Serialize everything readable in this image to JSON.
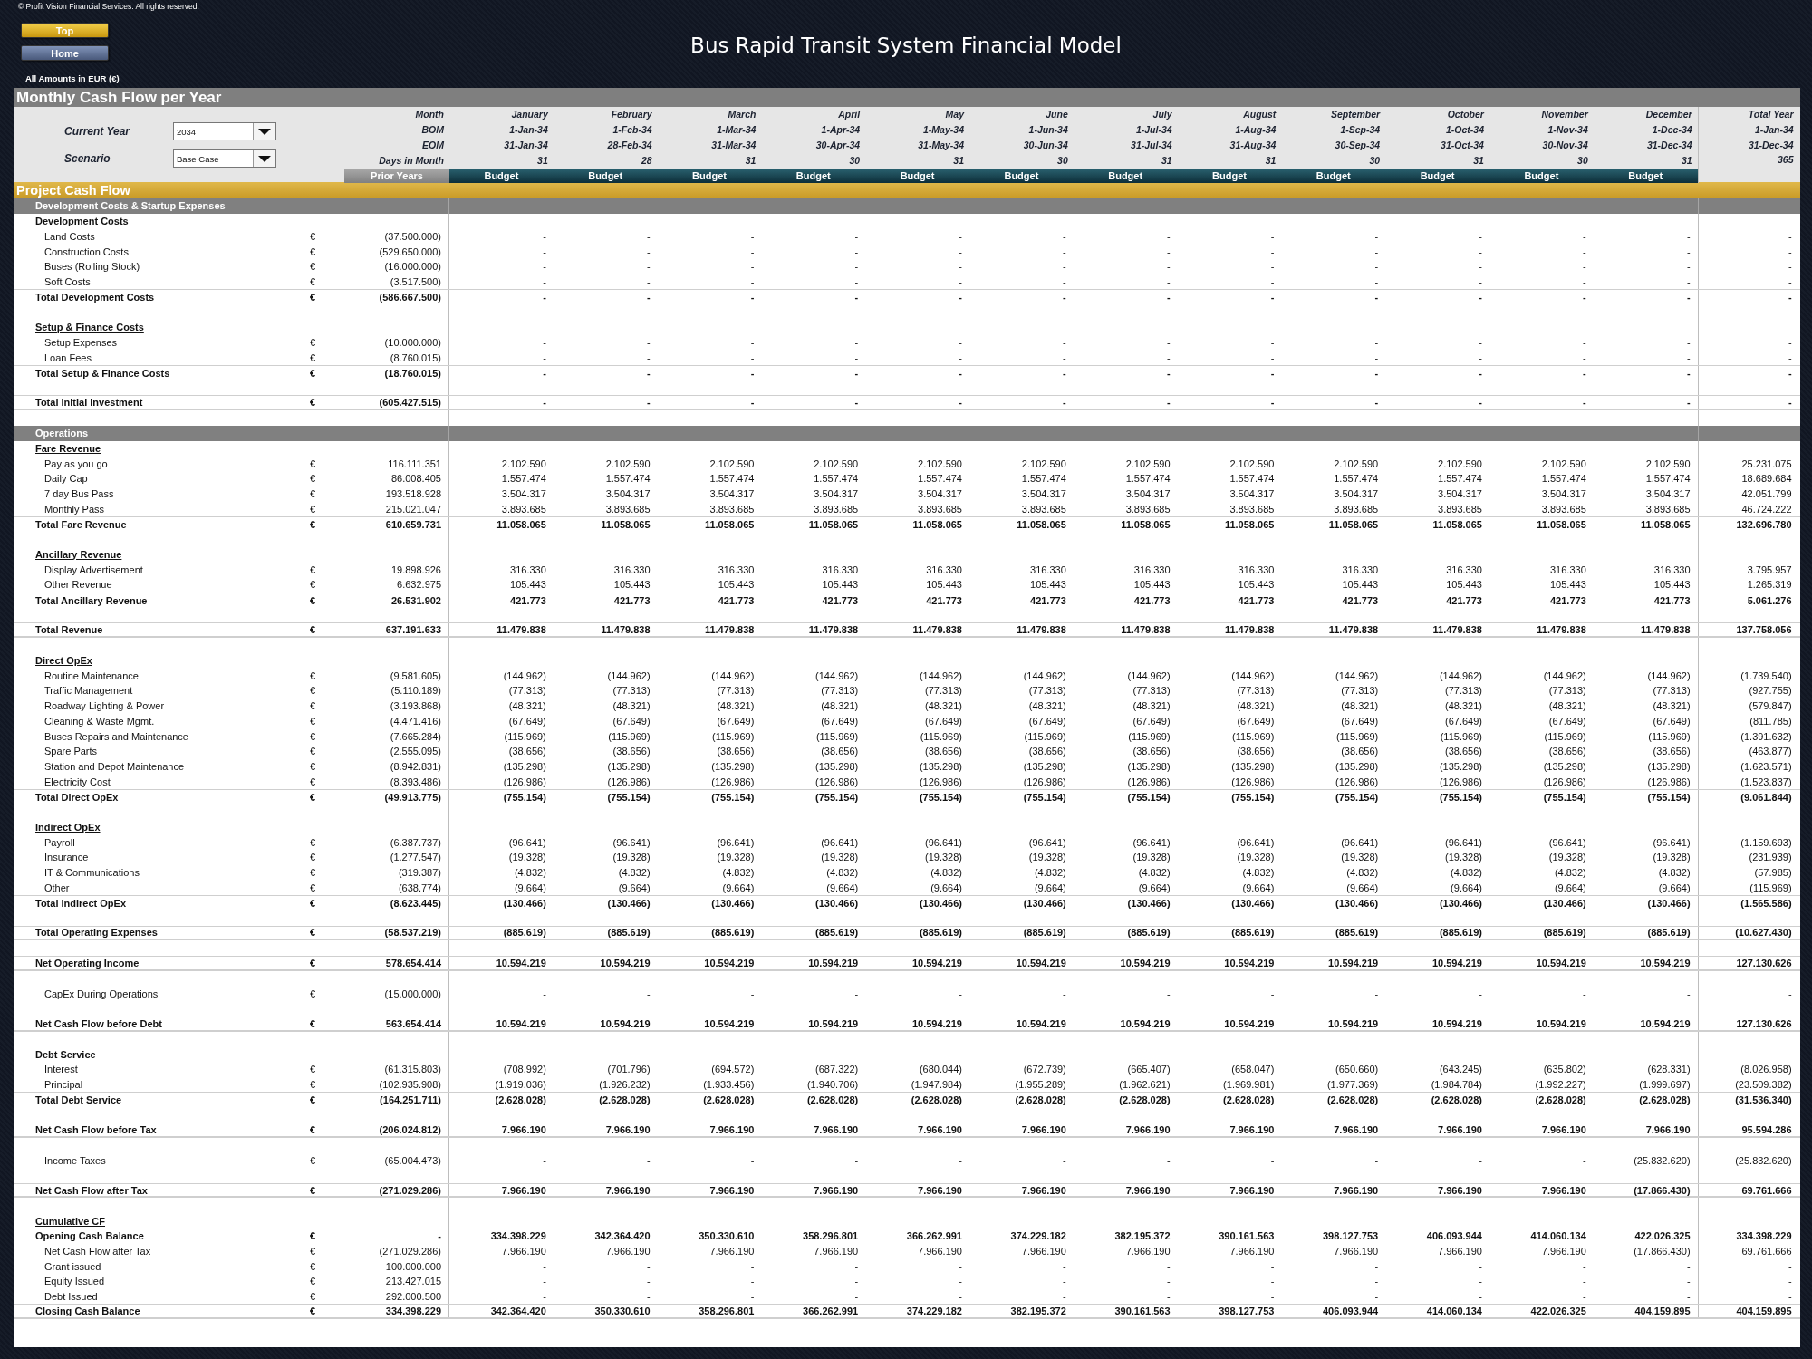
{
  "copyright": "© Profit Vision Financial Services. All rights reserved.",
  "nav_buttons": [
    "Top",
    "Home"
  ],
  "title": "Bus Rapid Transit System Financial Model",
  "amounts_note": "All Amounts in  EUR (€)",
  "sheet_title": "Monthly Cash Flow per Year",
  "controls": [
    {
      "label": "Current Year",
      "value": "2034"
    },
    {
      "label": "Scenario",
      "value": "Base Case"
    }
  ],
  "header_labels": {
    "month": "Month",
    "bom": "BOM",
    "eom": "EOM",
    "days": "Days in Month",
    "prior": "Prior Years"
  },
  "columns": [
    {
      "month": "January",
      "bom": "1-Jan-34",
      "eom": "31-Jan-34",
      "days": "31",
      "status": "Budget"
    },
    {
      "month": "February",
      "bom": "1-Feb-34",
      "eom": "28-Feb-34",
      "days": "28",
      "status": "Budget"
    },
    {
      "month": "March",
      "bom": "1-Mar-34",
      "eom": "31-Mar-34",
      "days": "31",
      "status": "Budget"
    },
    {
      "month": "April",
      "bom": "1-Apr-34",
      "eom": "30-Apr-34",
      "days": "30",
      "status": "Budget"
    },
    {
      "month": "May",
      "bom": "1-May-34",
      "eom": "31-May-34",
      "days": "31",
      "status": "Budget"
    },
    {
      "month": "June",
      "bom": "1-Jun-34",
      "eom": "30-Jun-34",
      "days": "30",
      "status": "Budget"
    },
    {
      "month": "July",
      "bom": "1-Jul-34",
      "eom": "31-Jul-34",
      "days": "31",
      "status": "Budget"
    },
    {
      "month": "August",
      "bom": "1-Aug-34",
      "eom": "31-Aug-34",
      "days": "31",
      "status": "Budget"
    },
    {
      "month": "September",
      "bom": "1-Sep-34",
      "eom": "30-Sep-34",
      "days": "30",
      "status": "Budget"
    },
    {
      "month": "October",
      "bom": "1-Oct-34",
      "eom": "31-Oct-34",
      "days": "31",
      "status": "Budget"
    },
    {
      "month": "November",
      "bom": "1-Nov-34",
      "eom": "30-Nov-34",
      "days": "30",
      "status": "Budget"
    },
    {
      "month": "December",
      "bom": "1-Dec-34",
      "eom": "31-Dec-34",
      "days": "31",
      "status": "Budget"
    }
  ],
  "total_column": {
    "month": "Total Year",
    "bom": "1-Jan-34",
    "eom": "31-Dec-34",
    "days": "365"
  },
  "block_title": "Project Cash Flow",
  "rows": [
    {
      "kind": "section",
      "label": "Development Costs & Startup Expenses"
    },
    {
      "kind": "group",
      "label": "Development Costs"
    },
    {
      "kind": "item",
      "label": "Land Costs",
      "currency": "€",
      "prior": "(37.500.000)",
      "months": [
        "-",
        "-",
        "-",
        "-",
        "-",
        "-",
        "-",
        "-",
        "-",
        "-",
        "-",
        "-"
      ],
      "total": "-"
    },
    {
      "kind": "item",
      "label": "Construction Costs",
      "currency": "€",
      "prior": "(529.650.000)",
      "months": [
        "-",
        "-",
        "-",
        "-",
        "-",
        "-",
        "-",
        "-",
        "-",
        "-",
        "-",
        "-"
      ],
      "total": "-"
    },
    {
      "kind": "item",
      "label": "Buses (Rolling Stock)",
      "currency": "€",
      "prior": "(16.000.000)",
      "months": [
        "-",
        "-",
        "-",
        "-",
        "-",
        "-",
        "-",
        "-",
        "-",
        "-",
        "-",
        "-"
      ],
      "total": "-"
    },
    {
      "kind": "item",
      "label": "Soft Costs",
      "currency": "€",
      "prior": "(3.517.500)",
      "months": [
        "-",
        "-",
        "-",
        "-",
        "-",
        "-",
        "-",
        "-",
        "-",
        "-",
        "-",
        "-"
      ],
      "total": "-"
    },
    {
      "kind": "total",
      "label": "Total Development Costs",
      "currency": "€",
      "prior": "(586.667.500)",
      "months": [
        "-",
        "-",
        "-",
        "-",
        "-",
        "-",
        "-",
        "-",
        "-",
        "-",
        "-",
        "-"
      ],
      "total": "-"
    },
    {
      "kind": "blank"
    },
    {
      "kind": "group",
      "label": "Setup & Finance Costs"
    },
    {
      "kind": "item",
      "label": "Setup Expenses",
      "currency": "€",
      "prior": "(10.000.000)",
      "months": [
        "-",
        "-",
        "-",
        "-",
        "-",
        "-",
        "-",
        "-",
        "-",
        "-",
        "-",
        "-"
      ],
      "total": "-"
    },
    {
      "kind": "item",
      "label": "Loan Fees",
      "currency": "€",
      "prior": "(8.760.015)",
      "months": [
        "-",
        "-",
        "-",
        "-",
        "-",
        "-",
        "-",
        "-",
        "-",
        "-",
        "-",
        "-"
      ],
      "total": "-"
    },
    {
      "kind": "total",
      "label": "Total Setup & Finance Costs",
      "currency": "€",
      "prior": "(18.760.015)",
      "months": [
        "-",
        "-",
        "-",
        "-",
        "-",
        "-",
        "-",
        "-",
        "-",
        "-",
        "-",
        "-"
      ],
      "total": "-"
    },
    {
      "kind": "blank"
    },
    {
      "kind": "net",
      "label": "Total Initial Investment",
      "currency": "€",
      "prior": "(605.427.515)",
      "months": [
        "-",
        "-",
        "-",
        "-",
        "-",
        "-",
        "-",
        "-",
        "-",
        "-",
        "-",
        "-"
      ],
      "total": "-"
    },
    {
      "kind": "blank"
    },
    {
      "kind": "section",
      "label": "Operations"
    },
    {
      "kind": "group",
      "label": "Fare Revenue"
    },
    {
      "kind": "item",
      "label": "Pay as you go",
      "currency": "€",
      "prior": "116.111.351",
      "months": [
        "2.102.590",
        "2.102.590",
        "2.102.590",
        "2.102.590",
        "2.102.590",
        "2.102.590",
        "2.102.590",
        "2.102.590",
        "2.102.590",
        "2.102.590",
        "2.102.590",
        "2.102.590"
      ],
      "total": "25.231.075"
    },
    {
      "kind": "item",
      "label": "Daily Cap",
      "currency": "€",
      "prior": "86.008.405",
      "months": [
        "1.557.474",
        "1.557.474",
        "1.557.474",
        "1.557.474",
        "1.557.474",
        "1.557.474",
        "1.557.474",
        "1.557.474",
        "1.557.474",
        "1.557.474",
        "1.557.474",
        "1.557.474"
      ],
      "total": "18.689.684"
    },
    {
      "kind": "item",
      "label": "7 day Bus Pass",
      "currency": "€",
      "prior": "193.518.928",
      "months": [
        "3.504.317",
        "3.504.317",
        "3.504.317",
        "3.504.317",
        "3.504.317",
        "3.504.317",
        "3.504.317",
        "3.504.317",
        "3.504.317",
        "3.504.317",
        "3.504.317",
        "3.504.317"
      ],
      "total": "42.051.799"
    },
    {
      "kind": "item",
      "label": "Monthly Pass",
      "currency": "€",
      "prior": "215.021.047",
      "months": [
        "3.893.685",
        "3.893.685",
        "3.893.685",
        "3.893.685",
        "3.893.685",
        "3.893.685",
        "3.893.685",
        "3.893.685",
        "3.893.685",
        "3.893.685",
        "3.893.685",
        "3.893.685"
      ],
      "total": "46.724.222"
    },
    {
      "kind": "total",
      "label": "Total Fare Revenue",
      "currency": "€",
      "prior": "610.659.731",
      "months": [
        "11.058.065",
        "11.058.065",
        "11.058.065",
        "11.058.065",
        "11.058.065",
        "11.058.065",
        "11.058.065",
        "11.058.065",
        "11.058.065",
        "11.058.065",
        "11.058.065",
        "11.058.065"
      ],
      "total": "132.696.780"
    },
    {
      "kind": "blank"
    },
    {
      "kind": "group",
      "label": "Ancillary Revenue"
    },
    {
      "kind": "item",
      "label": "Display Advertisement",
      "currency": "€",
      "prior": "19.898.926",
      "months": [
        "316.330",
        "316.330",
        "316.330",
        "316.330",
        "316.330",
        "316.330",
        "316.330",
        "316.330",
        "316.330",
        "316.330",
        "316.330",
        "316.330"
      ],
      "total": "3.795.957"
    },
    {
      "kind": "item",
      "label": "Other Revenue",
      "currency": "€",
      "prior": "6.632.975",
      "months": [
        "105.443",
        "105.443",
        "105.443",
        "105.443",
        "105.443",
        "105.443",
        "105.443",
        "105.443",
        "105.443",
        "105.443",
        "105.443",
        "105.443"
      ],
      "total": "1.265.319"
    },
    {
      "kind": "total",
      "label": "Total Ancillary Revenue",
      "currency": "€",
      "prior": "26.531.902",
      "months": [
        "421.773",
        "421.773",
        "421.773",
        "421.773",
        "421.773",
        "421.773",
        "421.773",
        "421.773",
        "421.773",
        "421.773",
        "421.773",
        "421.773"
      ],
      "total": "5.061.276"
    },
    {
      "kind": "blank"
    },
    {
      "kind": "net",
      "label": "Total Revenue",
      "currency": "€",
      "prior": "637.191.633",
      "months": [
        "11.479.838",
        "11.479.838",
        "11.479.838",
        "11.479.838",
        "11.479.838",
        "11.479.838",
        "11.479.838",
        "11.479.838",
        "11.479.838",
        "11.479.838",
        "11.479.838",
        "11.479.838"
      ],
      "total": "137.758.056"
    },
    {
      "kind": "blank"
    },
    {
      "kind": "group",
      "label": "Direct OpEx"
    },
    {
      "kind": "item",
      "label": "Routine Maintenance",
      "currency": "€",
      "prior": "(9.581.605)",
      "months": [
        "(144.962)",
        "(144.962)",
        "(144.962)",
        "(144.962)",
        "(144.962)",
        "(144.962)",
        "(144.962)",
        "(144.962)",
        "(144.962)",
        "(144.962)",
        "(144.962)",
        "(144.962)"
      ],
      "total": "(1.739.540)"
    },
    {
      "kind": "item",
      "label": "Traffic Management",
      "currency": "€",
      "prior": "(5.110.189)",
      "months": [
        "(77.313)",
        "(77.313)",
        "(77.313)",
        "(77.313)",
        "(77.313)",
        "(77.313)",
        "(77.313)",
        "(77.313)",
        "(77.313)",
        "(77.313)",
        "(77.313)",
        "(77.313)"
      ],
      "total": "(927.755)"
    },
    {
      "kind": "item",
      "label": "Roadway Lighting & Power",
      "currency": "€",
      "prior": "(3.193.868)",
      "months": [
        "(48.321)",
        "(48.321)",
        "(48.321)",
        "(48.321)",
        "(48.321)",
        "(48.321)",
        "(48.321)",
        "(48.321)",
        "(48.321)",
        "(48.321)",
        "(48.321)",
        "(48.321)"
      ],
      "total": "(579.847)"
    },
    {
      "kind": "item",
      "label": "Cleaning & Waste Mgmt.",
      "currency": "€",
      "prior": "(4.471.416)",
      "months": [
        "(67.649)",
        "(67.649)",
        "(67.649)",
        "(67.649)",
        "(67.649)",
        "(67.649)",
        "(67.649)",
        "(67.649)",
        "(67.649)",
        "(67.649)",
        "(67.649)",
        "(67.649)"
      ],
      "total": "(811.785)"
    },
    {
      "kind": "item",
      "label": "Buses Repairs and Maintenance",
      "currency": "€",
      "prior": "(7.665.284)",
      "months": [
        "(115.969)",
        "(115.969)",
        "(115.969)",
        "(115.969)",
        "(115.969)",
        "(115.969)",
        "(115.969)",
        "(115.969)",
        "(115.969)",
        "(115.969)",
        "(115.969)",
        "(115.969)"
      ],
      "total": "(1.391.632)"
    },
    {
      "kind": "item",
      "label": "Spare Parts",
      "currency": "€",
      "prior": "(2.555.095)",
      "months": [
        "(38.656)",
        "(38.656)",
        "(38.656)",
        "(38.656)",
        "(38.656)",
        "(38.656)",
        "(38.656)",
        "(38.656)",
        "(38.656)",
        "(38.656)",
        "(38.656)",
        "(38.656)"
      ],
      "total": "(463.877)"
    },
    {
      "kind": "item",
      "label": "Station and Depot Maintenance",
      "currency": "€",
      "prior": "(8.942.831)",
      "months": [
        "(135.298)",
        "(135.298)",
        "(135.298)",
        "(135.298)",
        "(135.298)",
        "(135.298)",
        "(135.298)",
        "(135.298)",
        "(135.298)",
        "(135.298)",
        "(135.298)",
        "(135.298)"
      ],
      "total": "(1.623.571)"
    },
    {
      "kind": "item",
      "label": "Electricity Cost",
      "currency": "€",
      "prior": "(8.393.486)",
      "months": [
        "(126.986)",
        "(126.986)",
        "(126.986)",
        "(126.986)",
        "(126.986)",
        "(126.986)",
        "(126.986)",
        "(126.986)",
        "(126.986)",
        "(126.986)",
        "(126.986)",
        "(126.986)"
      ],
      "total": "(1.523.837)"
    },
    {
      "kind": "total",
      "label": "Total Direct OpEx",
      "currency": "€",
      "prior": "(49.913.775)",
      "months": [
        "(755.154)",
        "(755.154)",
        "(755.154)",
        "(755.154)",
        "(755.154)",
        "(755.154)",
        "(755.154)",
        "(755.154)",
        "(755.154)",
        "(755.154)",
        "(755.154)",
        "(755.154)"
      ],
      "total": "(9.061.844)"
    },
    {
      "kind": "blank"
    },
    {
      "kind": "group",
      "label": "Indirect OpEx"
    },
    {
      "kind": "item",
      "label": "Payroll",
      "currency": "€",
      "prior": "(6.387.737)",
      "months": [
        "(96.641)",
        "(96.641)",
        "(96.641)",
        "(96.641)",
        "(96.641)",
        "(96.641)",
        "(96.641)",
        "(96.641)",
        "(96.641)",
        "(96.641)",
        "(96.641)",
        "(96.641)"
      ],
      "total": "(1.159.693)"
    },
    {
      "kind": "item",
      "label": "Insurance",
      "currency": "€",
      "prior": "(1.277.547)",
      "months": [
        "(19.328)",
        "(19.328)",
        "(19.328)",
        "(19.328)",
        "(19.328)",
        "(19.328)",
        "(19.328)",
        "(19.328)",
        "(19.328)",
        "(19.328)",
        "(19.328)",
        "(19.328)"
      ],
      "total": "(231.939)"
    },
    {
      "kind": "item",
      "label": "IT & Communications",
      "currency": "€",
      "prior": "(319.387)",
      "months": [
        "(4.832)",
        "(4.832)",
        "(4.832)",
        "(4.832)",
        "(4.832)",
        "(4.832)",
        "(4.832)",
        "(4.832)",
        "(4.832)",
        "(4.832)",
        "(4.832)",
        "(4.832)"
      ],
      "total": "(57.985)"
    },
    {
      "kind": "item",
      "label": "Other",
      "currency": "€",
      "prior": "(638.774)",
      "months": [
        "(9.664)",
        "(9.664)",
        "(9.664)",
        "(9.664)",
        "(9.664)",
        "(9.664)",
        "(9.664)",
        "(9.664)",
        "(9.664)",
        "(9.664)",
        "(9.664)",
        "(9.664)"
      ],
      "total": "(115.969)"
    },
    {
      "kind": "total",
      "label": "Total Indirect OpEx",
      "currency": "€",
      "prior": "(8.623.445)",
      "months": [
        "(130.466)",
        "(130.466)",
        "(130.466)",
        "(130.466)",
        "(130.466)",
        "(130.466)",
        "(130.466)",
        "(130.466)",
        "(130.466)",
        "(130.466)",
        "(130.466)",
        "(130.466)"
      ],
      "total": "(1.565.586)"
    },
    {
      "kind": "blank"
    },
    {
      "kind": "net",
      "label": "Total Operating Expenses",
      "currency": "€",
      "prior": "(58.537.219)",
      "months": [
        "(885.619)",
        "(885.619)",
        "(885.619)",
        "(885.619)",
        "(885.619)",
        "(885.619)",
        "(885.619)",
        "(885.619)",
        "(885.619)",
        "(885.619)",
        "(885.619)",
        "(885.619)"
      ],
      "total": "(10.627.430)"
    },
    {
      "kind": "blank"
    },
    {
      "kind": "net",
      "label": "Net Operating Income",
      "currency": "€",
      "prior": "578.654.414",
      "months": [
        "10.594.219",
        "10.594.219",
        "10.594.219",
        "10.594.219",
        "10.594.219",
        "10.594.219",
        "10.594.219",
        "10.594.219",
        "10.594.219",
        "10.594.219",
        "10.594.219",
        "10.594.219"
      ],
      "total": "127.130.626"
    },
    {
      "kind": "blank"
    },
    {
      "kind": "item",
      "label": "CapEx During Operations",
      "currency": "€",
      "prior": "(15.000.000)",
      "months": [
        "-",
        "-",
        "-",
        "-",
        "-",
        "-",
        "-",
        "-",
        "-",
        "-",
        "-",
        "-"
      ],
      "total": "-"
    },
    {
      "kind": "blank"
    },
    {
      "kind": "net",
      "label": "Net Cash Flow before Debt",
      "currency": "€",
      "prior": "563.654.414",
      "months": [
        "10.594.219",
        "10.594.219",
        "10.594.219",
        "10.594.219",
        "10.594.219",
        "10.594.219",
        "10.594.219",
        "10.594.219",
        "10.594.219",
        "10.594.219",
        "10.594.219",
        "10.594.219"
      ],
      "total": "127.130.626"
    },
    {
      "kind": "blank"
    },
    {
      "kind": "heading",
      "label": "Debt Service"
    },
    {
      "kind": "item",
      "label": "Interest",
      "currency": "€",
      "prior": "(61.315.803)",
      "months": [
        "(708.992)",
        "(701.796)",
        "(694.572)",
        "(687.322)",
        "(680.044)",
        "(672.739)",
        "(665.407)",
        "(658.047)",
        "(650.660)",
        "(643.245)",
        "(635.802)",
        "(628.331)"
      ],
      "total": "(8.026.958)"
    },
    {
      "kind": "item",
      "label": "Principal",
      "currency": "€",
      "prior": "(102.935.908)",
      "months": [
        "(1.919.036)",
        "(1.926.232)",
        "(1.933.456)",
        "(1.940.706)",
        "(1.947.984)",
        "(1.955.289)",
        "(1.962.621)",
        "(1.969.981)",
        "(1.977.369)",
        "(1.984.784)",
        "(1.992.227)",
        "(1.999.697)"
      ],
      "total": "(23.509.382)"
    },
    {
      "kind": "total",
      "label": "Total Debt Service",
      "currency": "€",
      "prior": "(164.251.711)",
      "months": [
        "(2.628.028)",
        "(2.628.028)",
        "(2.628.028)",
        "(2.628.028)",
        "(2.628.028)",
        "(2.628.028)",
        "(2.628.028)",
        "(2.628.028)",
        "(2.628.028)",
        "(2.628.028)",
        "(2.628.028)",
        "(2.628.028)"
      ],
      "total": "(31.536.340)"
    },
    {
      "kind": "blank"
    },
    {
      "kind": "net",
      "label": "Net Cash Flow before Tax",
      "currency": "€",
      "prior": "(206.024.812)",
      "months": [
        "7.966.190",
        "7.966.190",
        "7.966.190",
        "7.966.190",
        "7.966.190",
        "7.966.190",
        "7.966.190",
        "7.966.190",
        "7.966.190",
        "7.966.190",
        "7.966.190",
        "7.966.190"
      ],
      "total": "95.594.286"
    },
    {
      "kind": "blank"
    },
    {
      "kind": "item",
      "label": "Income Taxes",
      "currency": "€",
      "prior": "(65.004.473)",
      "months": [
        "-",
        "-",
        "-",
        "-",
        "-",
        "-",
        "-",
        "-",
        "-",
        "-",
        "-",
        "(25.832.620)"
      ],
      "total": "(25.832.620)"
    },
    {
      "kind": "blank"
    },
    {
      "kind": "net",
      "label": "Net Cash Flow after Tax",
      "currency": "€",
      "prior": "(271.029.286)",
      "months": [
        "7.966.190",
        "7.966.190",
        "7.966.190",
        "7.966.190",
        "7.966.190",
        "7.966.190",
        "7.966.190",
        "7.966.190",
        "7.966.190",
        "7.966.190",
        "7.966.190",
        "(17.866.430)"
      ],
      "total": "69.761.666"
    },
    {
      "kind": "blank"
    },
    {
      "kind": "group",
      "label": "Cumulative CF"
    },
    {
      "kind": "subtotal",
      "label": "Opening Cash Balance",
      "currency": "€",
      "prior": "-",
      "months": [
        "334.398.229",
        "342.364.420",
        "350.330.610",
        "358.296.801",
        "366.262.991",
        "374.229.182",
        "382.195.372",
        "390.161.563",
        "398.127.753",
        "406.093.944",
        "414.060.134",
        "422.026.325"
      ],
      "total": "334.398.229"
    },
    {
      "kind": "item",
      "label": "Net Cash Flow after Tax",
      "currency": "€",
      "prior": "(271.029.286)",
      "months": [
        "7.966.190",
        "7.966.190",
        "7.966.190",
        "7.966.190",
        "7.966.190",
        "7.966.190",
        "7.966.190",
        "7.966.190",
        "7.966.190",
        "7.966.190",
        "7.966.190",
        "(17.866.430)"
      ],
      "total": "69.761.666"
    },
    {
      "kind": "item",
      "label": "Grant issued",
      "currency": "€",
      "prior": "100.000.000",
      "months": [
        "-",
        "-",
        "-",
        "-",
        "-",
        "-",
        "-",
        "-",
        "-",
        "-",
        "-",
        "-"
      ],
      "total": "-"
    },
    {
      "kind": "item",
      "label": "Equity Issued",
      "currency": "€",
      "prior": "213.427.015",
      "months": [
        "-",
        "-",
        "-",
        "-",
        "-",
        "-",
        "-",
        "-",
        "-",
        "-",
        "-",
        "-"
      ],
      "total": "-"
    },
    {
      "kind": "item",
      "label": "Debt Issued",
      "currency": "€",
      "prior": "292.000.500",
      "months": [
        "-",
        "-",
        "-",
        "-",
        "-",
        "-",
        "-",
        "-",
        "-",
        "-",
        "-",
        "-"
      ],
      "total": "-"
    },
    {
      "kind": "net",
      "label": "Closing Cash Balance",
      "currency": "€",
      "prior": "334.398.229",
      "months": [
        "342.364.420",
        "350.330.610",
        "358.296.801",
        "366.262.991",
        "374.229.182",
        "382.195.372",
        "390.161.563",
        "398.127.753",
        "406.093.944",
        "414.060.134",
        "422.026.325",
        "404.159.895"
      ],
      "total": "404.159.895"
    }
  ]
}
